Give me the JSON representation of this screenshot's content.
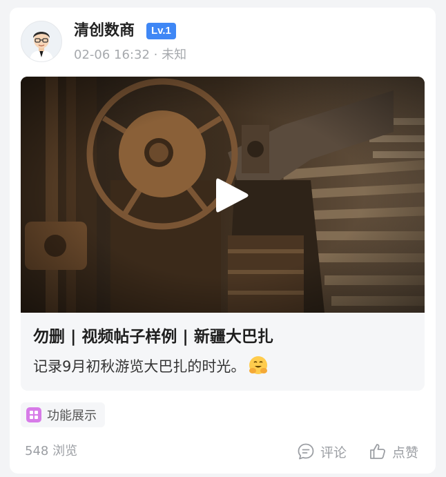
{
  "author": {
    "name": "清创数商",
    "level_badge": "Lv.1",
    "timestamp": "02-06 16:32",
    "separator": "·",
    "location": "未知"
  },
  "post": {
    "title": "勿删 | 视频帖子样例 | 新疆大巴扎",
    "description": "记录9月初秋游览大巴扎的时光。",
    "media_type": "video",
    "emoji_icon": "hugging-face-icon"
  },
  "tag": {
    "label": "功能展示",
    "icon": "feature-grid-icon"
  },
  "stats": {
    "views": "548 浏览",
    "comment_label": "评论",
    "like_label": "点赞"
  },
  "colors": {
    "badge": "#3f87f5",
    "tag_icon": "#d77be8"
  }
}
